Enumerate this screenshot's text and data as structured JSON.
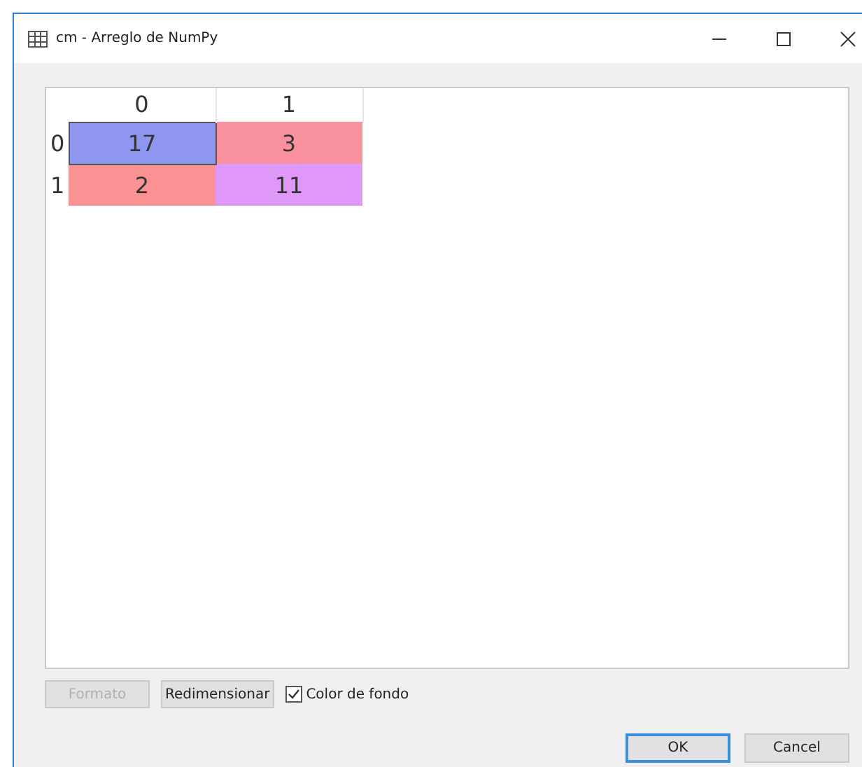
{
  "window": {
    "title": "cm - Arreglo de NumPy"
  },
  "table": {
    "columns": [
      "0",
      "1"
    ],
    "rows": [
      {
        "header": "0",
        "cells": [
          {
            "value": "17",
            "color": "#8f96f0",
            "selected": true
          },
          {
            "value": "3",
            "color": "#f9909e",
            "selected": false
          }
        ]
      },
      {
        "header": "1",
        "cells": [
          {
            "value": "2",
            "color": "#fa9192",
            "selected": false
          },
          {
            "value": "11",
            "color": "#df98f8",
            "selected": false
          }
        ]
      }
    ]
  },
  "controls": [
    {
      "kind": "button",
      "label": "Formato",
      "disabled": true
    },
    {
      "kind": "button",
      "label": "Redimensionar",
      "disabled": false
    },
    {
      "kind": "checkbox",
      "label": "Color de fondo",
      "checked": true
    }
  ],
  "buttons": [
    {
      "label": "OK",
      "default": true
    },
    {
      "label": "Cancel",
      "default": false
    }
  ]
}
